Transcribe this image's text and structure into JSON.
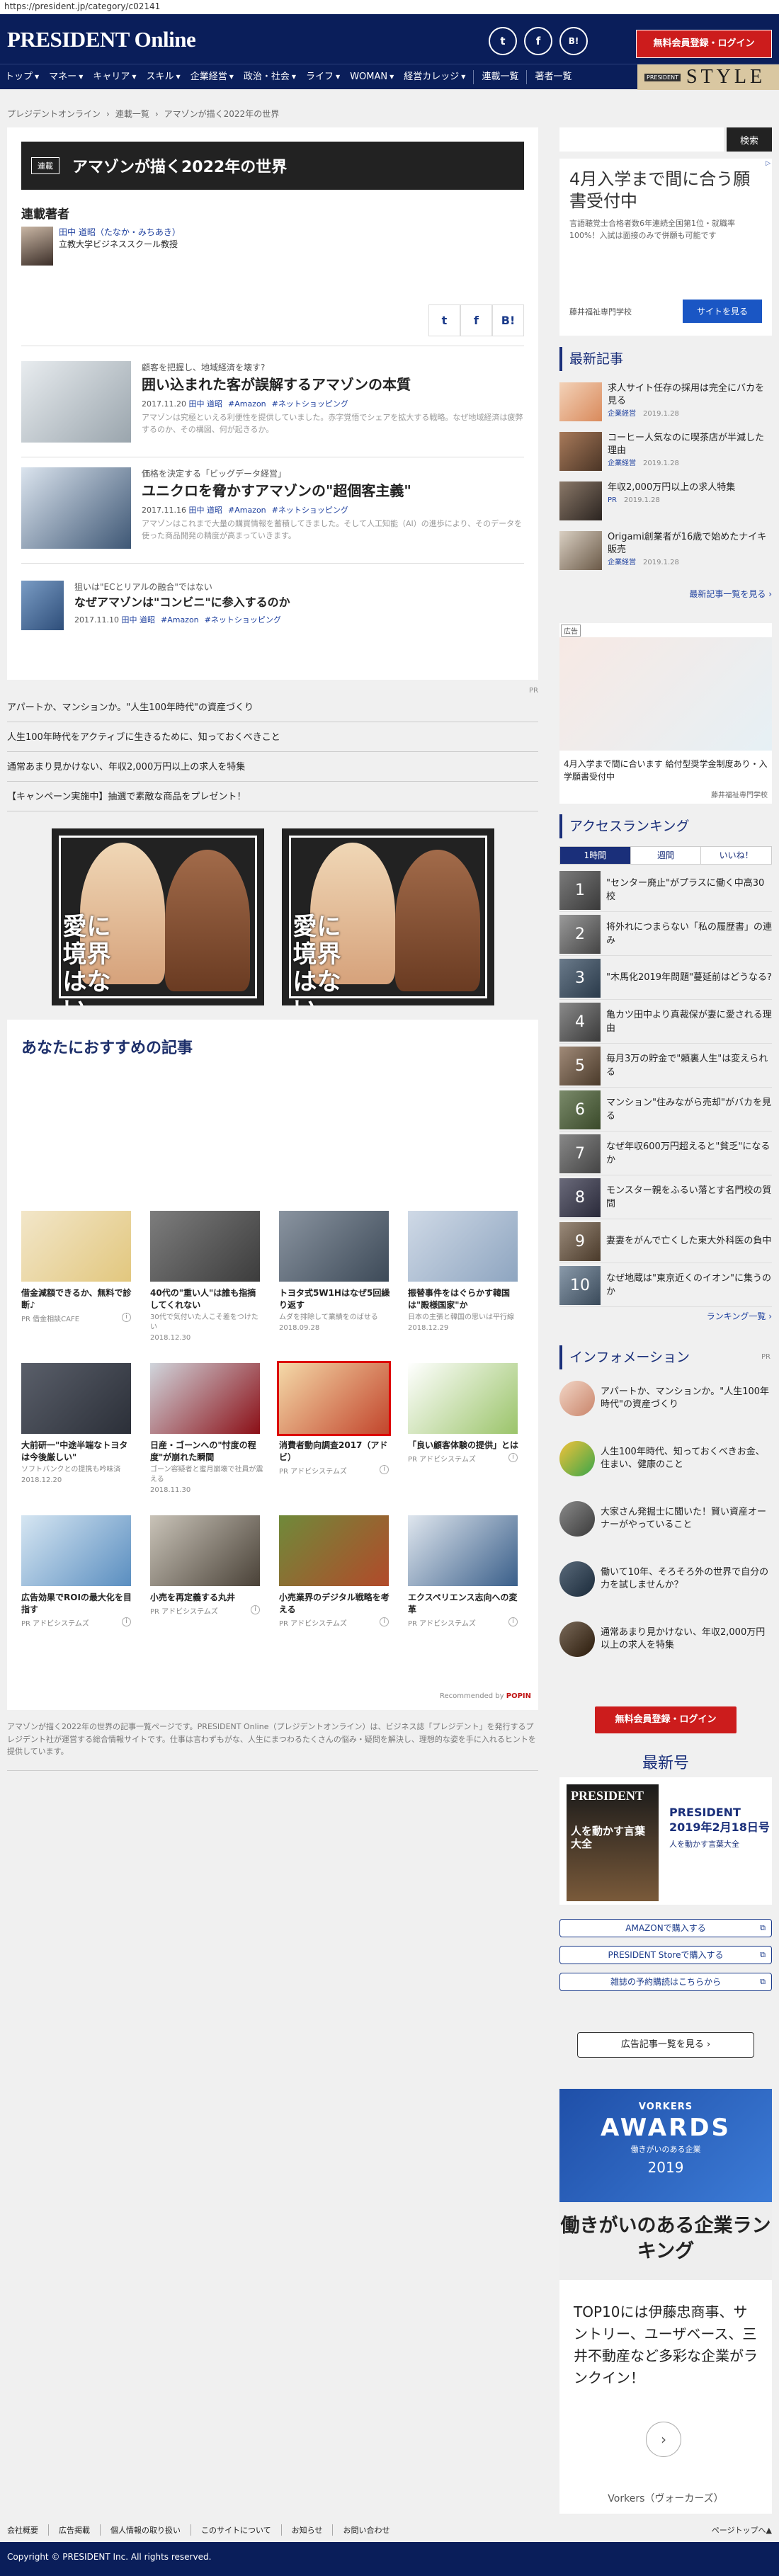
{
  "url": "https://president.jp/category/c02141",
  "header": {
    "logo": "PRESIDENT Online",
    "social": [
      "t",
      "f",
      "B!"
    ],
    "register_label": "無料会員登録・ログイン"
  },
  "nav": {
    "items": [
      "トップ",
      "マネー",
      "キャリア",
      "スキル",
      "企業経営",
      "政治・社会",
      "ライフ",
      "WOMAN",
      "経営カレッジ"
    ],
    "extra": [
      "連載一覧",
      "著者一覧"
    ],
    "style_small": "PRESIDENT",
    "style_big": "STYLE"
  },
  "breadcrumb": [
    "プレジデントオンライン",
    "連載一覧",
    "アマゾンが描く2022年の世界"
  ],
  "series": {
    "tag": "連載",
    "title": "アマゾンが描く2022年の世界",
    "authors_heading": "連載著者",
    "author_name": "田中 道昭（たなか・みちあき）",
    "author_org": "立教大学ビジネススクール教授"
  },
  "share": [
    "t",
    "f",
    "B!"
  ],
  "articles": [
    {
      "lead": "顧客を把握し、地域経済を壊す?",
      "title": "囲い込まれた客が誤解するアマゾンの本質",
      "date": "2017.11.20",
      "author": "田中 道昭",
      "tags": [
        "#Amazon",
        "#ネットショッピング"
      ],
      "desc": "アマゾンは究極といえる利便性を提供していました。赤字覚悟でシェアを拡大する戦略。なぜ地域経済は疲弊するのか、その構図、何が起きるか。"
    },
    {
      "lead": "価格を決定する「ビッグデータ経営」",
      "title": "ユニクロを脅かすアマゾンの\"超個客主義\"",
      "date": "2017.11.16",
      "author": "田中 道昭",
      "tags": [
        "#Amazon",
        "#ネットショッピング"
      ],
      "desc": "アマゾンはこれまで大量の購買情報を蓄積してきました。そして人工知能（AI）の進歩により、そのデータを使った商品開発の精度が高まっていきます。"
    },
    {
      "lead": "狙いは\"ECとリアルの融合\"ではない",
      "title": "なぜアマゾンは\"コンビニ\"に参入するのか",
      "date": "2017.11.10",
      "author": "田中 道昭",
      "tags": [
        "#Amazon",
        "#ネットショッピング"
      ],
      "desc": ""
    }
  ],
  "pr_label": "PR",
  "pr_links": [
    "アパートか、マンションか。\"人生100年時代\"の資産づくり",
    "人生100年時代をアクティブに生きるために、知っておくべきこと",
    "通常あまり見かけない、年収2,000万円以上の求人を特集",
    "【キャンペーン実施中】抽選で素敵な商品をプレゼント！"
  ],
  "banner_slogan": "愛に境界はない",
  "recommend": {
    "title": "あなたにおすすめの記事",
    "items": [
      {
        "title": "借金減額できるか、無料で診断♪",
        "sub": "",
        "meta": "PR 借金相談CAFE",
        "pr": true
      },
      {
        "title": "40代の\"重い人\"は誰も指摘してくれない",
        "sub": "30代で気付いた人こそ差をつけたい",
        "meta": "2018.12.30",
        "pr": false
      },
      {
        "title": "トヨタ式5W1Hはなぜ5回繰り返す",
        "sub": "ムダを排除して業績をのばせる",
        "meta": "2018.09.28",
        "pr": false
      },
      {
        "title": "振替事件をはぐらかす韓国は\"殿様国家\"か",
        "sub": "日本の主張と韓国の思いは平行線",
        "meta": "2018.12.29",
        "pr": false
      },
      {
        "title": "大前研一\"中途半端なトヨタは今後厳しい\"",
        "sub": "ソフトバンクとの提携も吟味済",
        "meta": "2018.12.20",
        "pr": false
      },
      {
        "title": "日産・ゴーンへの\"忖度の程度\"が崩れた瞬間",
        "sub": "ゴーン容疑者と蜜月崩壊で社員が震える",
        "meta": "2018.11.30",
        "pr": false
      },
      {
        "title": "消費者動向調査2017（アドビ）",
        "sub": "",
        "meta": "PR アドビシステムズ",
        "pr": true
      },
      {
        "title": "「良い顧客体験の提供」とは",
        "sub": "",
        "meta": "PR アドビシステムズ",
        "pr": true
      },
      {
        "title": "広告効果でROIの最大化を目指す",
        "sub": "",
        "meta": "PR アドビシステムズ",
        "pr": true
      },
      {
        "title": "小売を再定義する丸井",
        "sub": "",
        "meta": "PR アドビシステムズ",
        "pr": true
      },
      {
        "title": "小売業界のデジタル戦略を考える",
        "sub": "",
        "meta": "PR アドビシステムズ",
        "pr": true
      },
      {
        "title": "エクスペリエンス志向への変革",
        "sub": "",
        "meta": "PR アドビシステムズ",
        "pr": true
      }
    ],
    "credit_prefix": "Recommended by",
    "credit_brand": "POPIN"
  },
  "footer_desc": "アマゾンが描く2022年の世界の記事一覧ページです。PRESIDENT Online（プレジデントオンライン）は、ビジネス誌「プレジデント」を発行するプレジデント社が運営する総合情報サイトです。仕事は言わずもがな、人生にまつわるたくさんの悩み・疑問を解決し、理想的な姿を手に入れるヒントを提供しています。",
  "sidebar": {
    "search_label": "検索",
    "ad1": {
      "headline": "4月入学まで間に合う願書受付中",
      "desc": "言語聴覚士合格者数6年連続全国第1位・就職率100%！入試は面接のみで併願も可能です",
      "school": "藤井福祉専門学校",
      "button": "サイトを見る",
      "choice": "▷"
    },
    "latest_heading": "最新記事",
    "latest": [
      {
        "title": "求人サイト任存の採用は完全にバカを見る",
        "cat": "企業経営",
        "date": "2019.1.28"
      },
      {
        "title": "コーヒー人気なのに喫茶店が半減した理由",
        "cat": "企業経営",
        "date": "2019.1.28"
      },
      {
        "title": "年収2,000万円以上の求人特集",
        "cat": "PR",
        "date": "2019.1.28"
      },
      {
        "title": "Origami創業者が16歳で始めたナイキ販売",
        "cat": "企業経営",
        "date": "2019.1.28"
      }
    ],
    "latest_more": "最新記事一覧を見る ›",
    "ad2": {
      "label": "広告",
      "text": "4月入学まで間に合います 給付型奨学金制度あり・入学願書受付中",
      "src": "藤井福祉専門学校"
    },
    "ranking_heading": "アクセスランキング",
    "ranking_tabs": [
      "1時間",
      "週間",
      "いいね！"
    ],
    "ranking": [
      "\"センター廃止\"がプラスに働く中高30校",
      "将外れにつまらない「私の履歴書」の連み",
      "\"木馬化2019年問題\"蔓延前はどうなる?",
      "亀カツ田中より真裁保が妻に愛される理由",
      "毎月3万の貯金で\"頼裏人生\"は変えられる",
      "マンション\"住みながら売却\"がバカを見る",
      "なぜ年収600万円超えると\"貧乏\"になるか",
      "モンスター親をふるい落とす名門校の質問",
      "妻妻をがんで亡くした東大外科医の負中",
      "なぜ地蔵は\"東京近くのイオン\"に集うのか"
    ],
    "ranking_more": "ランキング一覧 ›",
    "info_heading": "インフォメーション",
    "info_pr": "PR",
    "info": [
      "アパートか、マンションか。\"人生100年時代\"の資産づくり",
      "人生100年時代、知っておくべきお金、住まい、健康のこと",
      "大家さん発掘士に聞いた！賢い資産オーナーがやっていること",
      "働いて10年、そろそろ外の世界で自分の力を試しませんか？",
      "通常あまり見かけない、年収2,000万円以上の求人を特集"
    ],
    "register_label": "無料会員登録・ログイン",
    "latest_issue_heading": "最新号",
    "issue_mast": "PRESIDENT",
    "issue_cover_text": "人を動かす言葉大全",
    "issue_name": "PRESIDENT 2019年2月18日号",
    "issue_sub": "人を動かす言葉大全",
    "buy_buttons": [
      "AMAZONで購入する",
      "PRESIDENT Storeで購入する",
      "雑誌の予約購読はこちらから"
    ],
    "adlist_button": "広告記事一覧を見る ›",
    "ad3": {
      "vorkers": "VORKERS",
      "awards": "AWARDS",
      "aw_sub": "働きがいのある企業",
      "year": "2019",
      "mid": "働きがいのある企業ランキング",
      "bot": "TOP10には伊藤忠商事、サントリー、ユーザベース、三井不動産など多彩な企業がランクイン！",
      "brand": "Vorkers（ヴォーカーズ）"
    }
  },
  "footer": {
    "links": [
      "会社概要",
      "広告掲載",
      "個人情報の取り扱い",
      "このサイトについて",
      "お知らせ",
      "お問い合わせ"
    ],
    "pagetop": "ページトップへ▲",
    "copyright": "Copyright © PRESIDENT Inc. All rights reserved."
  },
  "colors": {
    "navy": "#0a1e5a",
    "red": "#cc1c1c",
    "link": "#1d3f9e"
  }
}
